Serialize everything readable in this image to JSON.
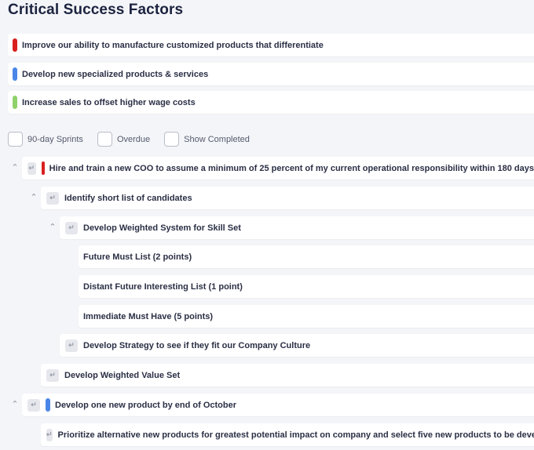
{
  "header": {
    "title": "Critical Success Factors"
  },
  "success_factors": [
    {
      "label": "Improve our ability to manufacture customized products that differentiate",
      "color": "#d91f1f"
    },
    {
      "label": "Develop new specialized products & services",
      "color": "#4a86e8"
    },
    {
      "label": "Increase sales to offset higher wage costs",
      "color": "#8fd16a"
    }
  ],
  "filters": [
    {
      "label": "90-day Sprints",
      "checked": false
    },
    {
      "label": "Overdue",
      "checked": false
    },
    {
      "label": "Show Completed",
      "checked": false
    }
  ],
  "icons": {
    "collapse": "chevron-up-icon",
    "subtask": "subtask-arrow-icon"
  },
  "tree": [
    {
      "label": "Hire and train a new COO to assume a minimum of 25 percent of my current operational responsibility within 180 days",
      "level": 0,
      "color": "#d91f1f",
      "expanded": true
    },
    {
      "label": "Identify short list of candidates",
      "level": 1,
      "expanded": true
    },
    {
      "label": "Develop Weighted System for Skill Set",
      "level": 2,
      "expanded": true
    },
    {
      "label": "Future Must List (2 points)",
      "level": 3
    },
    {
      "label": "Distant Future Interesting List (1 point)",
      "level": 3
    },
    {
      "label": "Immediate Must Have (5 points)",
      "level": 3
    },
    {
      "label": "Develop Strategy to see if they fit our Company Culture",
      "level": 2
    },
    {
      "label": "Develop Weighted Value Set",
      "level": 1
    },
    {
      "label": "Develop one new product by end of October",
      "level": 0,
      "color": "#4a86e8",
      "expanded": true
    },
    {
      "label": "Prioritize alternative new products for greatest potential impact on company and select five new products to be developed.",
      "level": 1
    }
  ]
}
